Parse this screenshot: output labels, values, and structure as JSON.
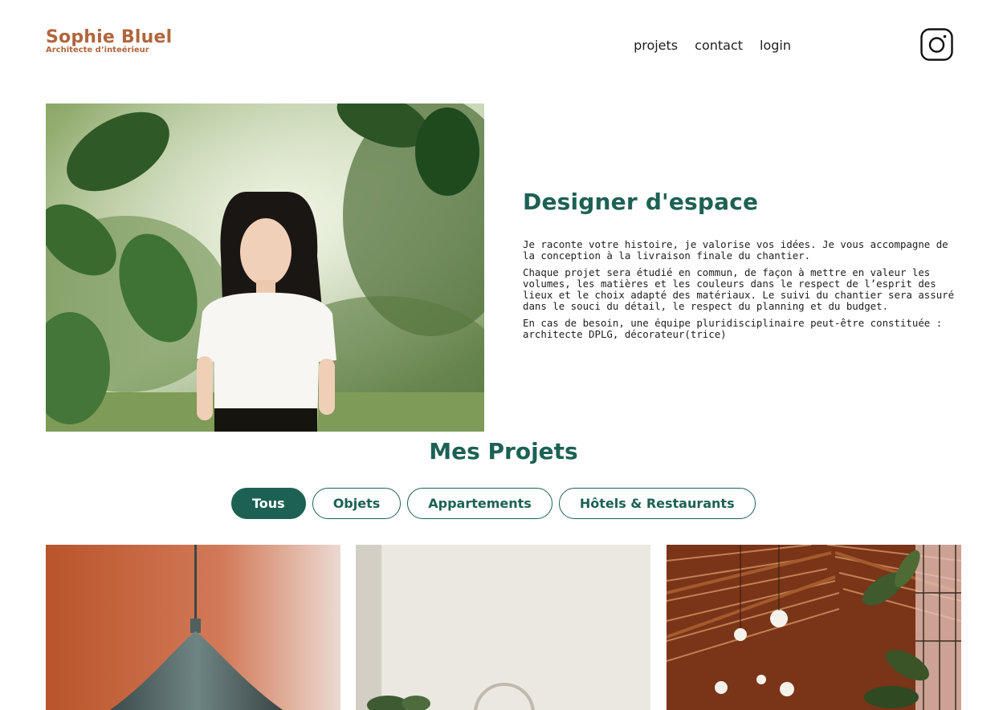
{
  "header": {
    "brand_name": "Sophie Bluel",
    "brand_tagline": "Architecte d’inteérieur",
    "nav": [
      "projets",
      "contact",
      "login"
    ],
    "social_icon": "instagram-icon"
  },
  "intro": {
    "title": "Designer d'espace",
    "paragraphs": [
      "Je raconte votre histoire, je valorise vos idées. Je vous accompagne de la conception à la livraison finale du chantier.",
      "Chaque projet sera étudié en commun, de façon à mettre en valeur les volumes, les matières et les couleurs dans le respect de l’esprit des lieux et le choix adapté des matériaux. Le suivi du chantier sera assuré dans le souci du détail, le respect du planning et du budget.",
      "En cas de besoin, une équipe pluridisciplinaire peut-être constituée : architecte DPLG, décorateur(trice)"
    ]
  },
  "projects": {
    "title": "Mes Projets",
    "filters": [
      "Tous",
      "Objets",
      "Appartements",
      "Hôtels & Restaurants"
    ],
    "active_filter": "Tous"
  },
  "colors": {
    "brand": "#b1663c",
    "accent": "#1d6154",
    "text": "#1d1d1d"
  }
}
